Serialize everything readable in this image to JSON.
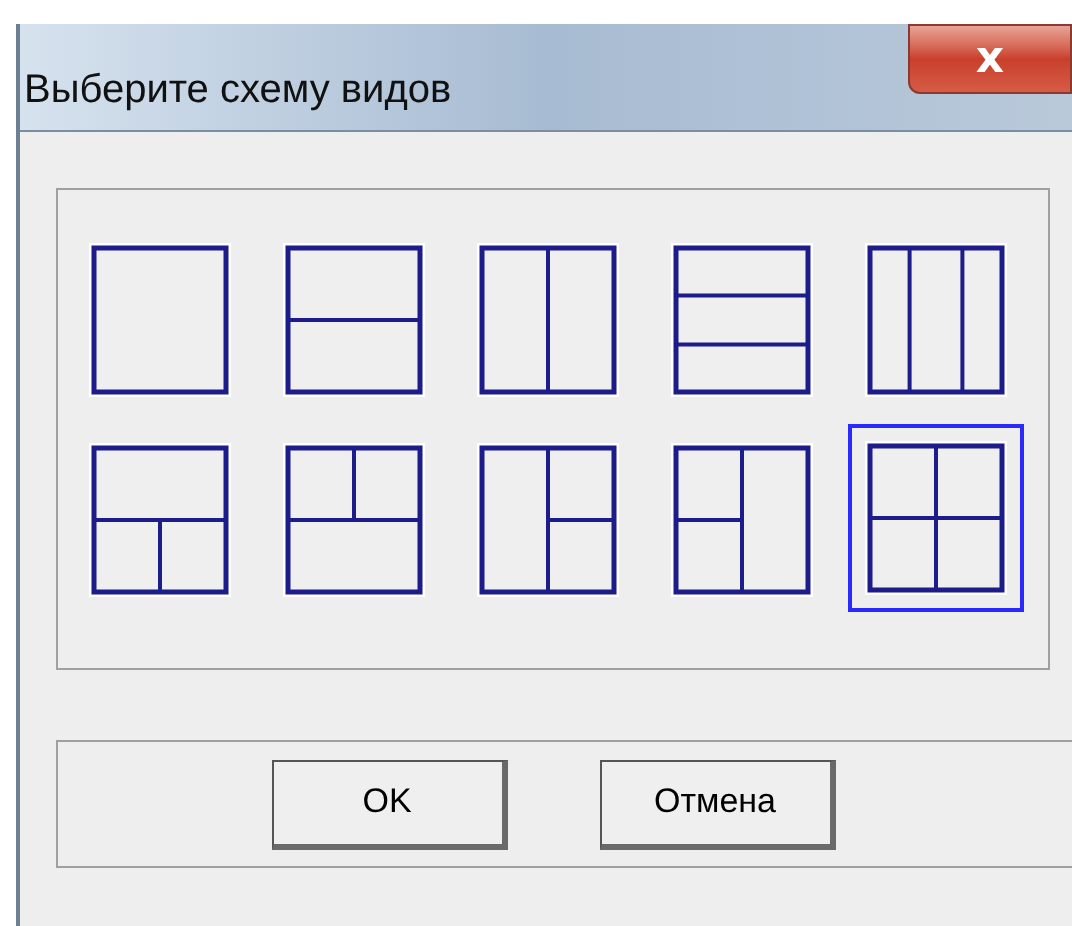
{
  "window": {
    "title": "Выберите схему видов",
    "close_label": "x"
  },
  "layouts": [
    {
      "kind": "single",
      "selected": false
    },
    {
      "kind": "rows2",
      "selected": false
    },
    {
      "kind": "cols2",
      "selected": false
    },
    {
      "kind": "rows3",
      "selected": false
    },
    {
      "kind": "cols3",
      "selected": false
    },
    {
      "kind": "top-split-bottom",
      "selected": false
    },
    {
      "kind": "split-top",
      "selected": false
    },
    {
      "kind": "split-right",
      "selected": false
    },
    {
      "kind": "split-left",
      "selected": false
    },
    {
      "kind": "grid4",
      "selected": true
    }
  ],
  "buttons": [
    {
      "label": "OK"
    },
    {
      "label": "Отмена"
    }
  ]
}
